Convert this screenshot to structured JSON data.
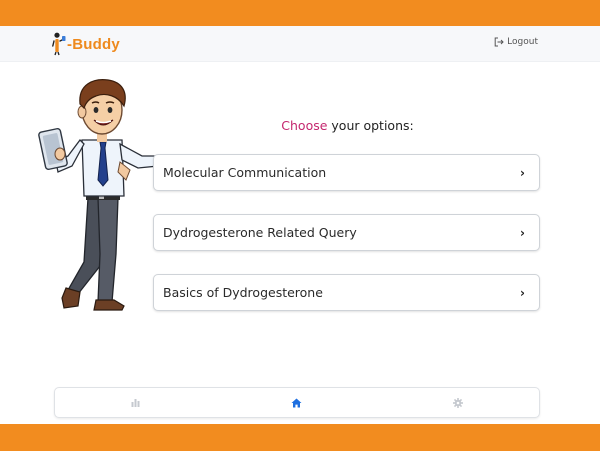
{
  "colors": {
    "band": "#f28c1f",
    "brand": "#ee8a1e",
    "accent_text": "#c4266e",
    "nav_active": "#1e6fe0",
    "nav_inactive": "#c5c9cf"
  },
  "header": {
    "brand_text": "-Buddy",
    "logout_label": "Logout",
    "logout_icon": "logout-icon"
  },
  "main": {
    "prompt": {
      "accent": "Choose",
      "rest": " your options:"
    },
    "options": [
      {
        "label": "Molecular Communication",
        "icon": "chevron-right-icon"
      },
      {
        "label": "Dydrogesterone Related Query",
        "icon": "chevron-right-icon"
      },
      {
        "label": "Basics of Dydrogesterone",
        "icon": "chevron-right-icon"
      }
    ]
  },
  "bottom_nav": {
    "items": [
      {
        "icon": "bar-chart-icon",
        "active": false
      },
      {
        "icon": "home-icon",
        "active": true
      },
      {
        "icon": "gear-icon",
        "active": false
      }
    ]
  }
}
